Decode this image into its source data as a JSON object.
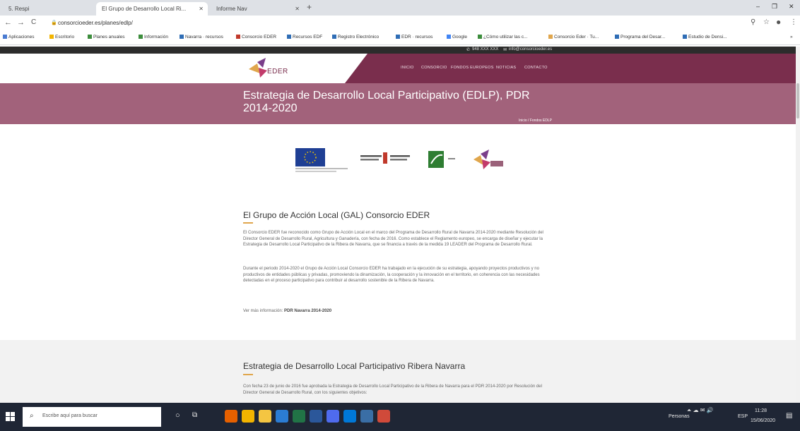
{
  "browser": {
    "tabs": [
      {
        "label": "5. Respi"
      },
      {
        "label": "El Grupo de Desarrollo Local Ri..."
      },
      {
        "label": "Informe Nav"
      }
    ],
    "new_tab_label": "+",
    "window_controls": [
      "–",
      "❐",
      "✕"
    ],
    "nav": {
      "back": "←",
      "forward": "→",
      "reload": "C"
    },
    "url": "consorcioeder.es/planes/edlp/",
    "bookmarks": [
      "Aplicaciones",
      "Escritorio",
      "Planes anuales",
      "Información",
      "Navarra · recursos",
      "Consorcio EDER",
      "Recursos EDF",
      "Registro Electrónico",
      "EDR · recursos",
      "Google",
      "¿Cómo utilizar las c...",
      "Consorcio Eder · Tu...",
      "Programa del Desar...",
      "Estudio de Densi..."
    ]
  },
  "site": {
    "top_contact": {
      "phone": "948 XXX XXX",
      "email": "info@consorcioeder.es"
    },
    "logo_text": "EDER",
    "nav_items": [
      "INICIO",
      "CONSORCIO",
      "FONDOS EUROPEOS",
      "NOTICIAS",
      "CONTACTO"
    ],
    "banner_title": "Estrategia de Desarrollo Local Participativo (EDLP), PDR 2014-2020",
    "breadcrumb": "Inicio / Fondos EDLP",
    "partner_logos": [
      "eu-flag-logo",
      "gobierno-de-navarra-logo",
      "leader-logo",
      "eder-logo"
    ],
    "section1": {
      "title": "El Grupo de Acción Local (GAL) Consorcio EDER",
      "paragraphs": [
        "El Consorcio EDER fue reconocido como Grupo de Acción Local en el marco del Programa de Desarrollo Rural de Navarra 2014-2020 mediante Resolución del Director General de Desarrollo Rural, Agricultura y Ganadería, con fecha de 2016. Como establece el Reglamento europeo, se encarga de diseñar y ejecutar la Estrategia de Desarrollo Local Participativo de la Ribera de Navarra, que se financia a través de la medida 19 LEADER del Programa de Desarrollo Rural.",
        "Durante el periodo 2014-2020 el Grupo de Acción Local Consorcio EDER ha trabajado en la ejecución de su estrategia, apoyando proyectos productivos y no productivos de entidades públicas y privadas, promoviendo la dinamización, la cooperación y la innovación en el territorio, en coherencia con las necesidades detectadas en el proceso participativo para contribuir al desarrollo sostenible de la Ribera de Navarra."
      ],
      "more_prefix": "Ver más información:",
      "more_link": "PDR Navarra 2014-2020"
    },
    "section2": {
      "title": "Estrategia de Desarrollo Local Participativo Ribera Navarra",
      "paragraph": "Con fecha 23 de junio de 2016 fue aprobada la Estrategia de Desarrollo Local Participativo de la Ribera de Navarra para el PDR 2014-2020 por Resolución del Director General de Desarrollo Rural, con los siguientes objetivos:"
    }
  },
  "taskbar": {
    "search_placeholder": "Escribe aquí para buscar",
    "tray_label": "Personas",
    "lang": "ESP",
    "time": "11:28",
    "date": "15/06/2020"
  },
  "colors": {
    "brand_maroon": "#7a2e4d",
    "banner_mauve": "#a2627b",
    "accent_orange": "#e0a64c"
  }
}
